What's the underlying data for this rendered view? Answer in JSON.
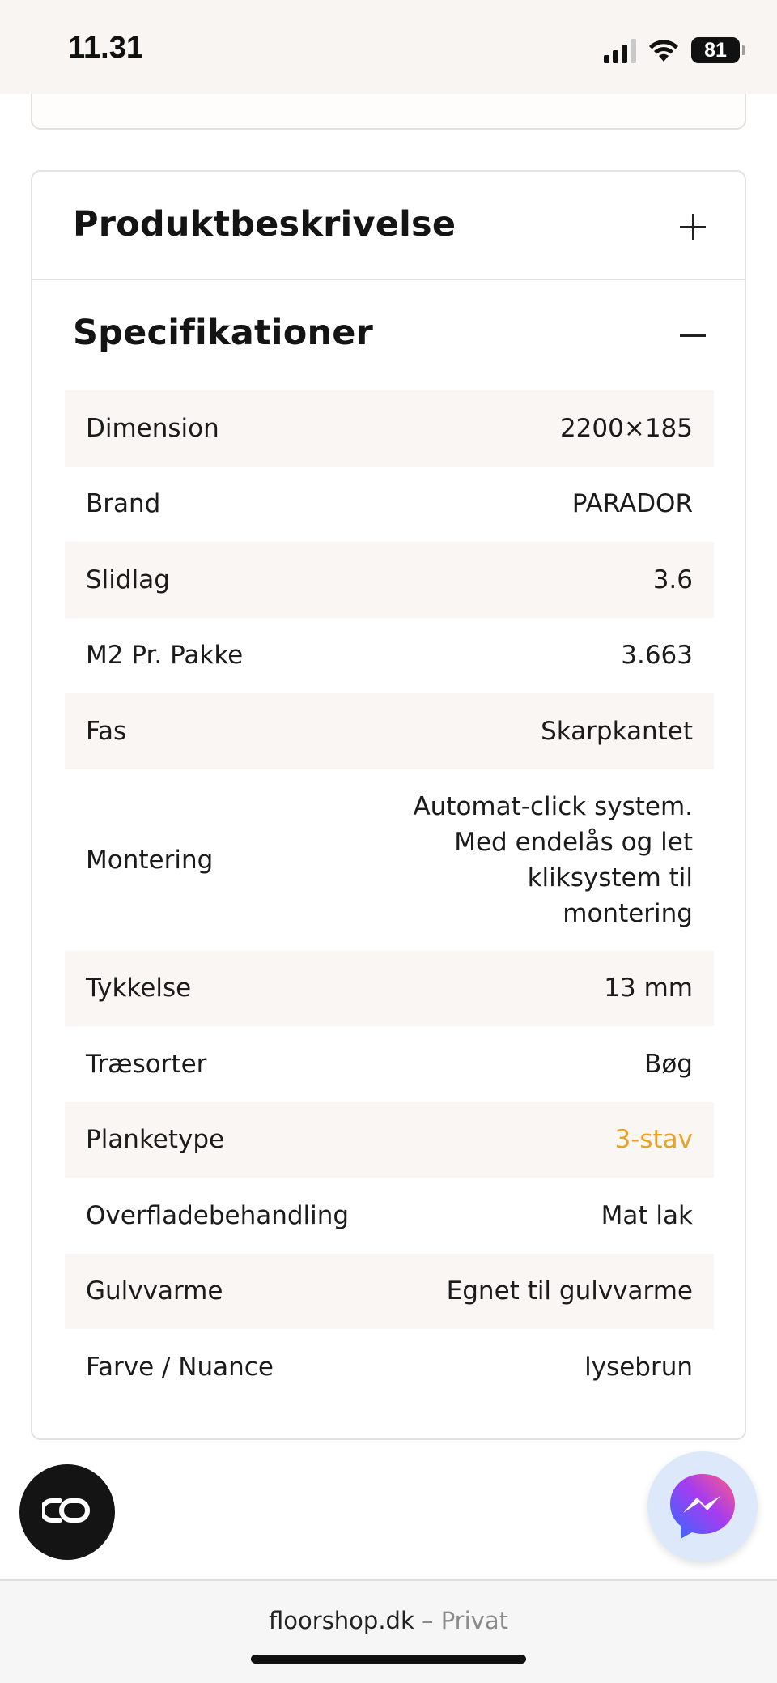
{
  "status_bar": {
    "time": "11.31",
    "battery": "81",
    "icons": [
      "signal-icon",
      "wifi-icon",
      "battery-icon"
    ]
  },
  "accordion": {
    "description": {
      "title": "Produktbeskrivelse",
      "icon": "plus-icon",
      "expanded": false
    },
    "specifications": {
      "title": "Specifikationer",
      "icon": "minus-icon",
      "expanded": true,
      "rows": [
        {
          "label": "Dimension",
          "value": "2200×185"
        },
        {
          "label": "Brand",
          "value": "PARADOR"
        },
        {
          "label": "Slidlag",
          "value": "3.6"
        },
        {
          "label": "M2 Pr. Pakke",
          "value": "3.663"
        },
        {
          "label": "Fas",
          "value": "Skarpkantet"
        },
        {
          "label": "Montering",
          "value": "Automat-click system. Med endelås og let kliksystem til montering"
        },
        {
          "label": "Tykkelse",
          "value": "13 mm"
        },
        {
          "label": "Træsorter",
          "value": "Bøg"
        },
        {
          "label": "Planketype",
          "value": "3-stav"
        },
        {
          "label": "Overfladebehandling",
          "value": "Mat lak"
        },
        {
          "label": "Gulvvarme",
          "value": "Egnet til gulvvarme"
        },
        {
          "label": "Farve / Nuance",
          "value": "lysebrun"
        }
      ]
    }
  },
  "floating": {
    "chat_icon": "chat-widget-icon",
    "messenger_icon": "messenger-icon"
  },
  "browser": {
    "domain": "floorshop.dk",
    "separator": " – ",
    "mode": "Privat"
  },
  "colors": {
    "accent_link": "#e8a227",
    "row_alt_bg": "#faf6f3",
    "status_bar_bg": "#f8f5f2"
  }
}
